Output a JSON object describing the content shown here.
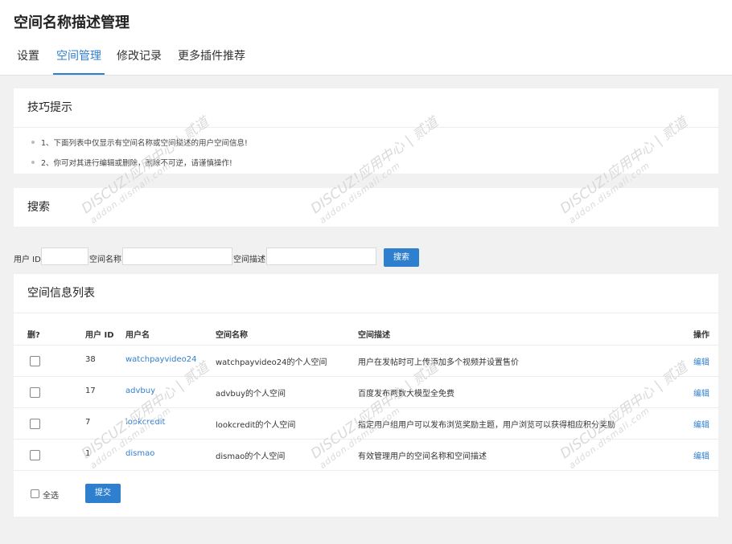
{
  "header": {
    "title": "空间名称描述管理",
    "tabs": [
      {
        "label": "设置"
      },
      {
        "label": "空间管理"
      },
      {
        "label": "修改记录"
      },
      {
        "label": "更多插件推荐"
      }
    ]
  },
  "tips": {
    "title": "技巧提示",
    "items": [
      "1、下面列表中仅显示有空间名称或空间描述的用户空间信息!",
      "2、你可对其进行编辑或删除，删除不可逆，请谨慎操作!"
    ]
  },
  "search": {
    "title": "搜索",
    "uid_label": "用户 ID",
    "name_label": "空间名称",
    "desc_label": "空间描述",
    "uid_value": "",
    "name_value": "",
    "desc_value": "",
    "button": "搜索"
  },
  "list": {
    "title": "空间信息列表",
    "columns": [
      "删?",
      "用户 ID",
      "用户名",
      "空间名称",
      "空间描述",
      "操作"
    ],
    "rows": [
      {
        "uid": "38",
        "username": "watchpayvideo24",
        "space_name": "watchpayvideo24的个人空间",
        "space_desc": "用户在发帖时可上传添加多个视频并设置售价",
        "action": "编辑"
      },
      {
        "uid": "17",
        "username": "advbuy",
        "space_name": "advbuy的个人空间",
        "space_desc": "百度发布两数大模型全免费",
        "action": "编辑"
      },
      {
        "uid": "7",
        "username": "lookcredit",
        "space_name": "lookcredit的个人空间",
        "space_desc": "指定用户组用户可以发布浏览奖励主题，用户浏览可以获得相应积分奖励",
        "action": "编辑"
      },
      {
        "uid": "1",
        "username": "dismao",
        "space_name": "dismao的个人空间",
        "space_desc": "有效管理用户的空间名称和空间描述",
        "action": "编辑"
      }
    ],
    "select_all_label": "全选",
    "submit_label": "提交"
  },
  "watermark": {
    "text": "DISCUZ!应用中心 | 贰道",
    "url": "addon.dismall.com"
  },
  "colors": {
    "accent": "#2f7fcf",
    "background": "#f1f1f1",
    "panel": "#ffffff"
  }
}
